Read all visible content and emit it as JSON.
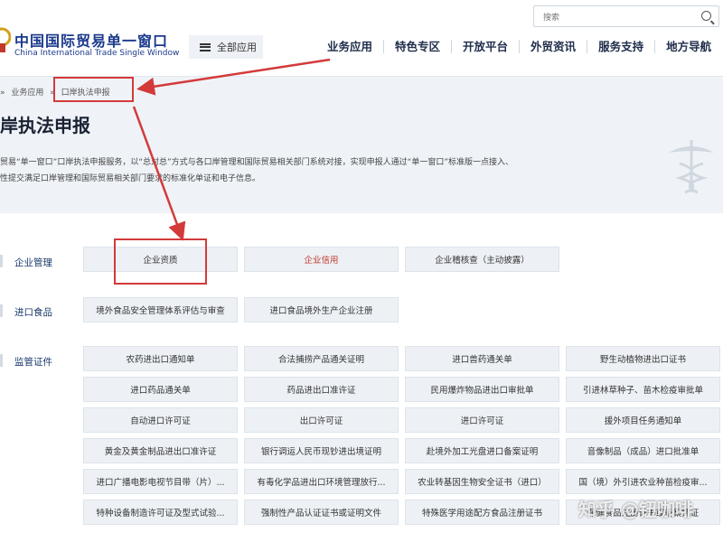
{
  "header": {
    "logo_cn": "中国国际贸易单一窗口",
    "logo_en": "China International Trade Single Window",
    "all_apps_label": "全部应用",
    "search_placeholder": "搜索",
    "nav": [
      "业务应用",
      "特色专区",
      "开放平台",
      "外贸资讯",
      "服务支持",
      "地方导航"
    ]
  },
  "breadcrumb": {
    "sep": "»",
    "parent": "业务应用",
    "current": "口岸执法申报"
  },
  "page": {
    "title": "岸执法申报",
    "desc_line1": "贸易“单一窗口”口岸执法申报服务，以“总对总”方式与各口岸管理和国际贸易相关部门系统对接，实现申报人通过“单一窗口”标准版一点接入、",
    "desc_line2": "性提交满足口岸管理和国际贸易相关部门要求的标准化单证和电子信息。"
  },
  "categories": {
    "enterprise": {
      "label": "企业管理",
      "items": [
        "企业资质",
        "企业信用",
        "企业稽核查（主动披露）"
      ]
    },
    "import_food": {
      "label": "进口食品",
      "items": [
        "境外食品安全管理体系评估与审查",
        "进口食品境外生产企业注册"
      ]
    },
    "certificates": {
      "label": "监管证件",
      "items": [
        "农药进出口通知单",
        "合法捕捞产品通关证明",
        "进口兽药通关单",
        "野生动植物进出口证书",
        "进口药品通关单",
        "药品进出口准许证",
        "民用爆炸物品进出口审批单",
        "引进林草种子、苗木检疫审批单",
        "自动进口许可证",
        "出口许可证",
        "进口许可证",
        "援外项目任务通知单",
        "黄金及黄金制品进出口准许证",
        "银行调运人民币现钞进出境证明",
        "赴境外加工光盘进口备案证明",
        "音像制品（成品）进口批准单",
        "进口广播电影电视节目带（片）...",
        "有毒化学品进出口环境管理放行...",
        "农业转基因生物安全证书（进口）",
        "国（境）外引进农业种苗检疫审...",
        "特种设备制造许可证及型式试验...",
        "强制性产品认证证书或证明文件",
        "特殊医学用途配方食品注册证书",
        "保健食品注册证书或备案凭证"
      ]
    }
  },
  "watermark": "知乎 @钮咖啡",
  "colors": {
    "annotation_red": "#d33a3a",
    "brand_blue": "#1b3a8c"
  }
}
